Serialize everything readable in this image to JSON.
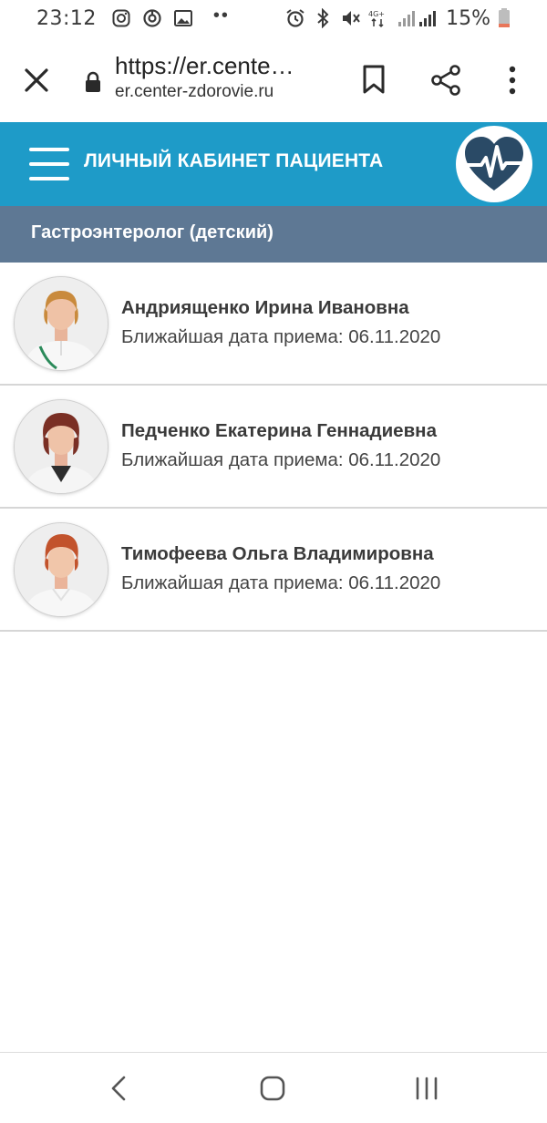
{
  "status_bar": {
    "time": "23:12",
    "battery": "15%",
    "network": "4G+",
    "dots": "••",
    "icons": [
      "instagram-icon",
      "sync-icon",
      "gallery-icon",
      "alarm-icon",
      "bluetooth-icon",
      "mute-icon",
      "signal-icon"
    ]
  },
  "browser": {
    "url_main": "https://er.cente…",
    "url_domain": "er.center-zdorovie.ru",
    "icons": [
      "close-icon",
      "lock-icon",
      "bookmark-icon",
      "share-icon",
      "more-icon"
    ]
  },
  "header": {
    "title": "ЛИЧНЫЙ КАБИНЕТ ПАЦИЕНТА",
    "logo_icon": "heart-pulse-icon",
    "color": "#1e9bc8"
  },
  "section": {
    "title": "Гастроэнтеролог (детский)",
    "color": "#5e7894"
  },
  "doctors": [
    {
      "name": "Андриященко Ирина Ивановна",
      "next_date": "Ближайшая дата приема: 06.11.2020"
    },
    {
      "name": "Педченко Екатерина Геннадиевна",
      "next_date": "Ближайшая дата приема: 06.11.2020"
    },
    {
      "name": "Тимофеева Ольга Владимировна",
      "next_date": "Ближайшая дата приема: 06.11.2020"
    }
  ],
  "nav": {
    "icons": [
      "back-icon",
      "home-icon",
      "recents-icon"
    ]
  }
}
